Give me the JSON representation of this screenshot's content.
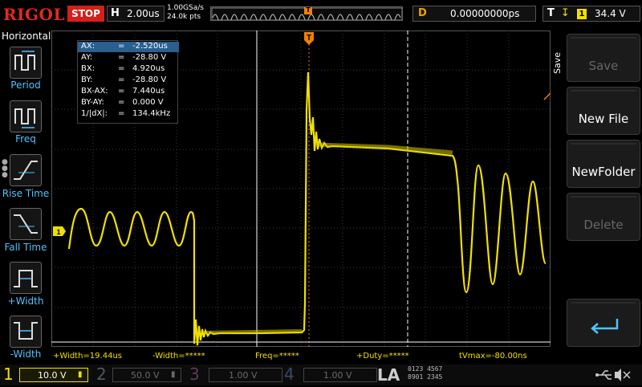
{
  "header": {
    "brand": "RIGOL",
    "run_state": "STOP",
    "timebase_label": "H",
    "timebase_value": "2.00us",
    "sample_rate": "1.00GSa/s",
    "memory_depth": "24.0k pts",
    "trigger_marker": "T",
    "delay_label": "D",
    "delay_value": "0.00000000ps",
    "trigger_label": "T",
    "trigger_channel": "1",
    "trigger_level": "34.4 V"
  },
  "left_panel": {
    "title": "Horizontal",
    "items": [
      {
        "label": "Period",
        "icon": "period-icon"
      },
      {
        "label": "Freq",
        "icon": "frequency-icon"
      },
      {
        "label": "Rise Time",
        "icon": "rise-time-icon"
      },
      {
        "label": "Fall Time",
        "icon": "fall-time-icon"
      },
      {
        "label": "+Width",
        "icon": "positive-width-icon"
      },
      {
        "label": "-Width",
        "icon": "negative-width-icon"
      }
    ]
  },
  "cursor_readout": [
    {
      "key": "AX:",
      "value": "-2.520us",
      "selected": true
    },
    {
      "key": "AY:",
      "value": "-28.80 V"
    },
    {
      "key": "BX:",
      "value": "4.920us"
    },
    {
      "key": "BY:",
      "value": "-28.80 V"
    },
    {
      "key": "BX-AX:",
      "value": "7.440us"
    },
    {
      "key": "BY-AY:",
      "value": "0.000 V"
    },
    {
      "key": "1/|dX|:",
      "value": "134.4kHz"
    }
  ],
  "measurements": [
    {
      "label": "+Width=19.44us"
    },
    {
      "label": "-Width=*****"
    },
    {
      "label": "Freq=*****"
    },
    {
      "label": "+Duty=*****"
    },
    {
      "label": "tVmax=-80.00ns"
    }
  ],
  "channel1_marker": "1",
  "right_panel": {
    "menu_title": "Save",
    "buttons": [
      {
        "label": "Save",
        "enabled": false
      },
      {
        "label": "New File",
        "enabled": true
      },
      {
        "label": "NewFolder",
        "enabled": true
      },
      {
        "label": "Delete",
        "enabled": false
      },
      {
        "label": "",
        "enabled": true,
        "icon": "enter-arrow-icon"
      }
    ]
  },
  "channels": [
    {
      "num": "1",
      "scale": "10.0 V",
      "color": "#f0e000",
      "active": true
    },
    {
      "num": "2",
      "scale": "50.0 V",
      "color": "#00c8d0",
      "active": false
    },
    {
      "num": "3",
      "scale": "1.00 V",
      "color": "#d040c0",
      "active": false
    },
    {
      "num": "4",
      "scale": "1.00 V",
      "color": "#3060ff",
      "active": false
    }
  ],
  "la_label": "LA",
  "la_digits": [
    "0123 4567",
    "8901 2345"
  ],
  "colors": {
    "ch1": "#f0e000",
    "brand": "#e02a1a",
    "accent": "#4fc3ff",
    "grid": "#3a3a3a",
    "delay": "#f0a000"
  }
}
